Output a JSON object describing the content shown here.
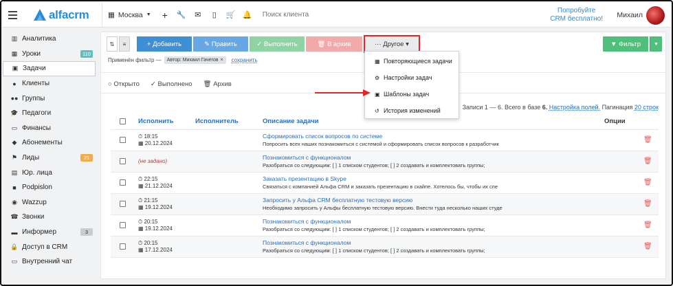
{
  "topbar": {
    "logo_text": "alfacrm",
    "branch": "Москва",
    "search_placeholder": "Поиск клиента",
    "promo_line1": "Попробуйте",
    "promo_line2": "CRM бесплатно!",
    "user_name": "Михаил"
  },
  "sidebar": {
    "items": [
      {
        "label": "Аналитика",
        "icon": "chart-icon"
      },
      {
        "label": "Уроки",
        "icon": "calendar-icon",
        "badge": "110"
      },
      {
        "label": "Задачи",
        "icon": "tasks-icon"
      },
      {
        "label": "Клиенты",
        "icon": "user-icon"
      },
      {
        "label": "Группы",
        "icon": "users-icon"
      },
      {
        "label": "Педагоги",
        "icon": "graduation-icon"
      },
      {
        "label": "Финансы",
        "icon": "money-icon"
      },
      {
        "label": "Абонементы",
        "icon": "tag-icon"
      },
      {
        "label": "Лиды",
        "icon": "lead-icon",
        "badge": "21"
      },
      {
        "label": "Юр. лица",
        "icon": "building-icon"
      },
      {
        "label": "Podpislon",
        "icon": "podpislon-icon"
      },
      {
        "label": "Wazzup",
        "icon": "whatsapp-icon"
      },
      {
        "label": "Звонки",
        "icon": "phone-icon"
      },
      {
        "label": "Информер",
        "icon": "message-icon",
        "badge": "3"
      },
      {
        "label": "Доступ в CRM",
        "icon": "lock-icon"
      },
      {
        "label": "Внутренний чат",
        "icon": "chat-icon"
      }
    ]
  },
  "toolbar": {
    "add": "+ Добавить",
    "edit": "✎ Править",
    "done": "✓ Выполнить",
    "archive": "🗑 В архив",
    "other": "··· Другое ▾",
    "filter": "▼ Фильтр"
  },
  "filter": {
    "applied_label": "Применён фильтр —",
    "chip": "Автор: Михаил Гачегов",
    "save_link": "сохранить"
  },
  "tabs": [
    "○ Открыто",
    "✓ Выполнено",
    "🗑 Архив"
  ],
  "dropdown": [
    {
      "label": "Повторяющиеся задачи",
      "icon": "table-icon"
    },
    {
      "label": "Настройки задач",
      "icon": "gear-icon"
    },
    {
      "label": "Шаблоны задач",
      "icon": "template-icon"
    },
    {
      "label": "История изменений",
      "icon": "history-icon"
    }
  ],
  "pagination": {
    "records_prefix": "Записи 1 — 6. Всего в базе",
    "total": "6.",
    "settings_link": "Настройка полей.",
    "page_prefix": "Пагинация",
    "page_link": "20 строк"
  },
  "table": {
    "headers": {
      "execute": "Исполнить",
      "executor": "Исполнитель",
      "description": "Описание задачи",
      "options": "Опции"
    },
    "rows": [
      {
        "time": "18:15",
        "date": "20.12.2024",
        "title": "Сформировать список вопросов по системе",
        "desc": "Попросить всех наших познакомиться с системой и сформировать список вопросов к разработчик"
      },
      {
        "none": "(не задано)",
        "title": "Познакомиться с функционалом",
        "desc": "Разобраться со следующим: [ ] 1 списком студентов; [ ] 2 создавать и комплектовать группы;"
      },
      {
        "time": "22:15",
        "date": "21.12.2024",
        "title": "Заказать презентацию в Skype",
        "desc": "Связаться с компанией Альфа CRM и заказать презентацию в скайпе. Хотелось бы, чтобы их спе"
      },
      {
        "time": "21:15",
        "date": "19.12.2024",
        "title": "Запросить у Альфа CRM бесплатную тестовую версию",
        "desc": "Необходимо запросить у Альфы бесплатную тестовую версию. Внести туда несколько наших студе"
      },
      {
        "time": "20:15",
        "date": "19.12.2024",
        "title": "Познакомиться с функционалом",
        "desc": "Разобраться со следующим: [ ] 1 списком студентов; [ ] 2 создавать и комплектовать группы;"
      },
      {
        "time": "20:15",
        "date": "17.12.2024",
        "title": "Познакомиться с функционалом",
        "desc": "Разобраться со следующим: [ ] 1 списком студентов; [ ] 2 создавать и комплектовать группы;"
      }
    ]
  },
  "colors": {
    "accent_blue": "#3e8fd3",
    "filter_green": "#4fbf7c",
    "highlight_red": "#e0262a"
  }
}
